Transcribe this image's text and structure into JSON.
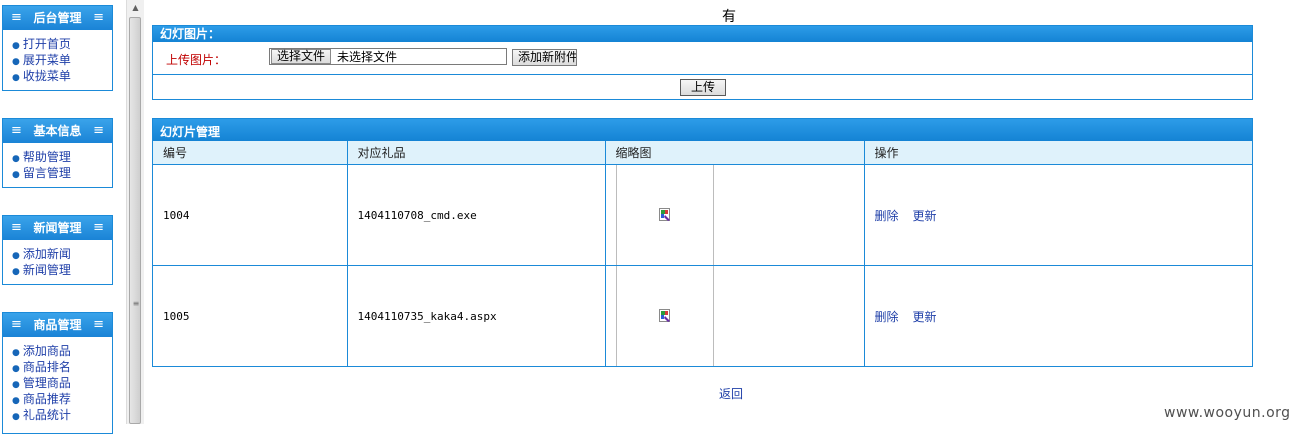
{
  "sidebar": {
    "sections": [
      {
        "title": "后台管理",
        "items": [
          "打开首页",
          "展开菜单",
          "收拢菜单"
        ]
      },
      {
        "title": "基本信息",
        "items": [
          "帮助管理",
          "留言管理"
        ]
      },
      {
        "title": "新闻管理",
        "items": [
          "添加新闻",
          "新闻管理"
        ]
      },
      {
        "title": "商品管理",
        "items": [
          "添加商品",
          "商品排名",
          "管理商品",
          "商品推荐",
          "礼品统计"
        ]
      }
    ]
  },
  "main": {
    "top_char": "有",
    "upload_panel": {
      "title": "幻灯图片：",
      "label": "上传图片：",
      "file_button": "选择文件",
      "file_status": "未选择文件",
      "add_button": "添加新附件",
      "submit": "上传"
    },
    "slides_panel": {
      "title": "幻灯片管理",
      "columns": [
        "编号",
        "对应礼品",
        "缩略图",
        "操作"
      ],
      "rows": [
        {
          "id": "1004",
          "gift": "1404110708_cmd.exe",
          "ops": [
            "删除",
            "更新"
          ]
        },
        {
          "id": "1005",
          "gift": "1404110735_kaka4.aspx",
          "ops": [
            "删除",
            "更新"
          ]
        }
      ]
    },
    "back_link": "返回"
  },
  "watermark": "www.wooyun.org",
  "colors": {
    "accent": "#1b8ad8",
    "header_cell": "#dff2fb",
    "label_red": "#c00000",
    "link": "#1f3fa8"
  }
}
